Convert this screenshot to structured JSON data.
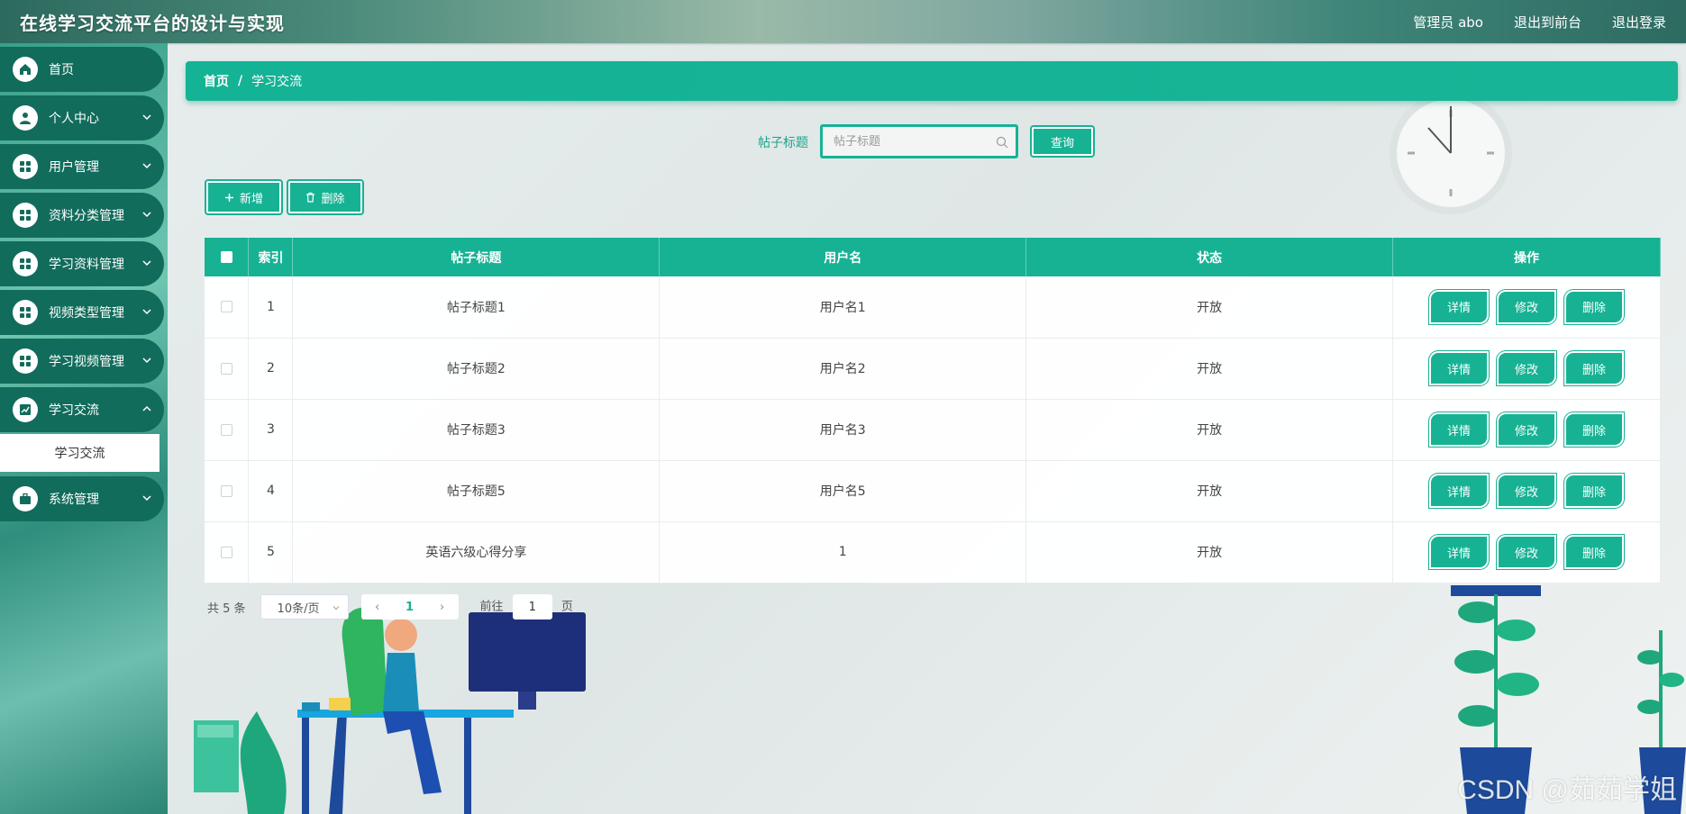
{
  "header": {
    "title": "在线学习交流平台的设计与实现",
    "admin": "管理员 abo",
    "to_front": "退出到前台",
    "logout": "退出登录"
  },
  "sidebar": {
    "items": [
      {
        "label": "首页",
        "icon": "home-icon"
      },
      {
        "label": "个人中心",
        "icon": "user-icon"
      },
      {
        "label": "用户管理",
        "icon": "grid-icon"
      },
      {
        "label": "资料分类管理",
        "icon": "grid-icon"
      },
      {
        "label": "学习资料管理",
        "icon": "grid-icon"
      },
      {
        "label": "视频类型管理",
        "icon": "grid-icon"
      },
      {
        "label": "学习视频管理",
        "icon": "grid-icon"
      },
      {
        "label": "学习交流",
        "icon": "chart-icon"
      },
      {
        "label": "系统管理",
        "icon": "briefcase-icon"
      }
    ],
    "submenu_label": "学习交流"
  },
  "breadcrumb": {
    "home": "首页",
    "sep": "/",
    "current": "学习交流"
  },
  "search": {
    "label": "帖子标题",
    "placeholder": "帖子标题",
    "button": "查询"
  },
  "toolbar": {
    "add": "新增",
    "delete": "删除"
  },
  "table": {
    "columns": [
      "索引",
      "帖子标题",
      "用户名",
      "状态",
      "操作"
    ],
    "rows": [
      {
        "index": "1",
        "title": "帖子标题1",
        "user": "用户名1",
        "status": "开放"
      },
      {
        "index": "2",
        "title": "帖子标题2",
        "user": "用户名2",
        "status": "开放"
      },
      {
        "index": "3",
        "title": "帖子标题3",
        "user": "用户名3",
        "status": "开放"
      },
      {
        "index": "4",
        "title": "帖子标题5",
        "user": "用户名5",
        "status": "开放"
      },
      {
        "index": "5",
        "title": "英语六级心得分享",
        "user": "1",
        "status": "开放"
      }
    ],
    "ops": {
      "detail": "详情",
      "edit": "修改",
      "delete": "删除"
    }
  },
  "pager": {
    "total": "共 5 条",
    "page_size": "10条/页",
    "current": "1",
    "goto_label": "前往",
    "goto_value": "1",
    "page_suffix": "页"
  },
  "watermark": "CSDN @茹茹学姐",
  "colors": {
    "accent": "#17b294",
    "sidebar_item": "#126c5b"
  }
}
